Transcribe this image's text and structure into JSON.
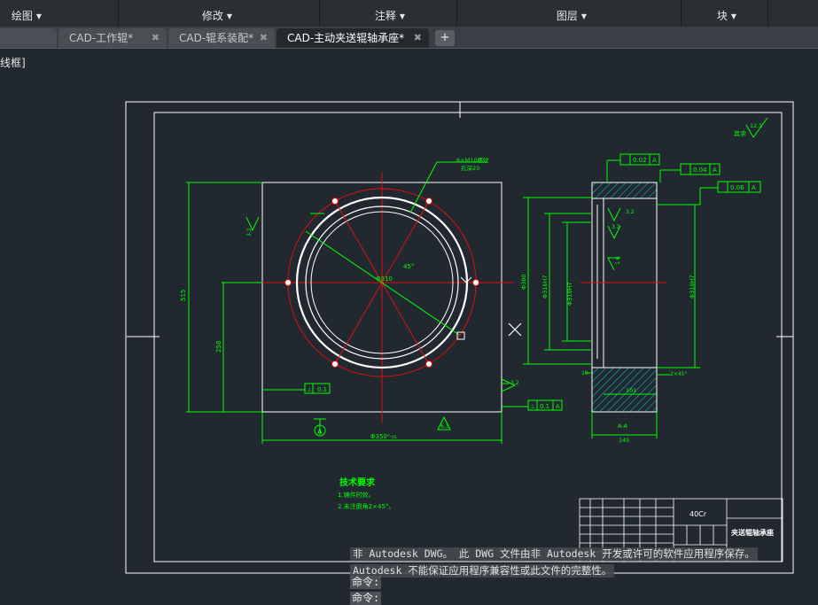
{
  "ribbon": {
    "panels": [
      {
        "label": "绘图"
      },
      {
        "label": "修改"
      },
      {
        "label": "注释"
      },
      {
        "label": "图层"
      },
      {
        "label": "块"
      }
    ]
  },
  "tabs": [
    {
      "label": "CAD-工作辊*",
      "active": false
    },
    {
      "label": "CAD-辊系装配*",
      "active": false
    },
    {
      "label": "CAD-主动夹送辊轴承座*",
      "active": true
    }
  ],
  "viewport": {
    "label": "线框]"
  },
  "drawing": {
    "front_view": {
      "width_dim": "Φ350⁰⋅₀₅",
      "height_dim": "515",
      "half_height_dim": "258",
      "circle_dim": "Φ310",
      "angle": "45°",
      "hole_note_1": "6×M10螺纹",
      "hole_note_2": "孔深20",
      "roughness_left": "3.2",
      "roughness_right": "3.2",
      "roughness_bottom": "6.3",
      "tol_left": "0.1",
      "tol_bottom": "0.1",
      "tol_symbol": "⊥",
      "datum": "A"
    },
    "section_view": {
      "tol_1": "0.02",
      "tol_2": "0.04",
      "tol_3": "0.06",
      "tol_datum": "A",
      "dim_1": "Φ380",
      "dim_2": "Φ316H7",
      "dim_3": "Φ310H7",
      "roughness_1": "3.2",
      "roughness_2": "3.2",
      "roughness_3": "1.6",
      "chamfer": "2×45°",
      "inner_dim": "101",
      "left_dim": "10",
      "width_dim": "145",
      "section_label": "A-A"
    },
    "roughness_corner": "12.5",
    "roughness_corner_prefix": "其余",
    "tech_title": "技术要求",
    "tech_notes": [
      "1.铸件时效。",
      "2.未注倒角2×45°。"
    ],
    "title_block": {
      "material": "40Cr",
      "part_name": "夹送辊轴承座"
    }
  },
  "command": {
    "messages": [
      "非 Autodesk DWG。 此 DWG 文件由非 Autodesk 开发或许可的软件应用程序保存。",
      "Autodesk 不能保证应用程序兼容性或此文件的完整性。"
    ],
    "prompt": "命令:",
    "prompt2": "命令:"
  }
}
